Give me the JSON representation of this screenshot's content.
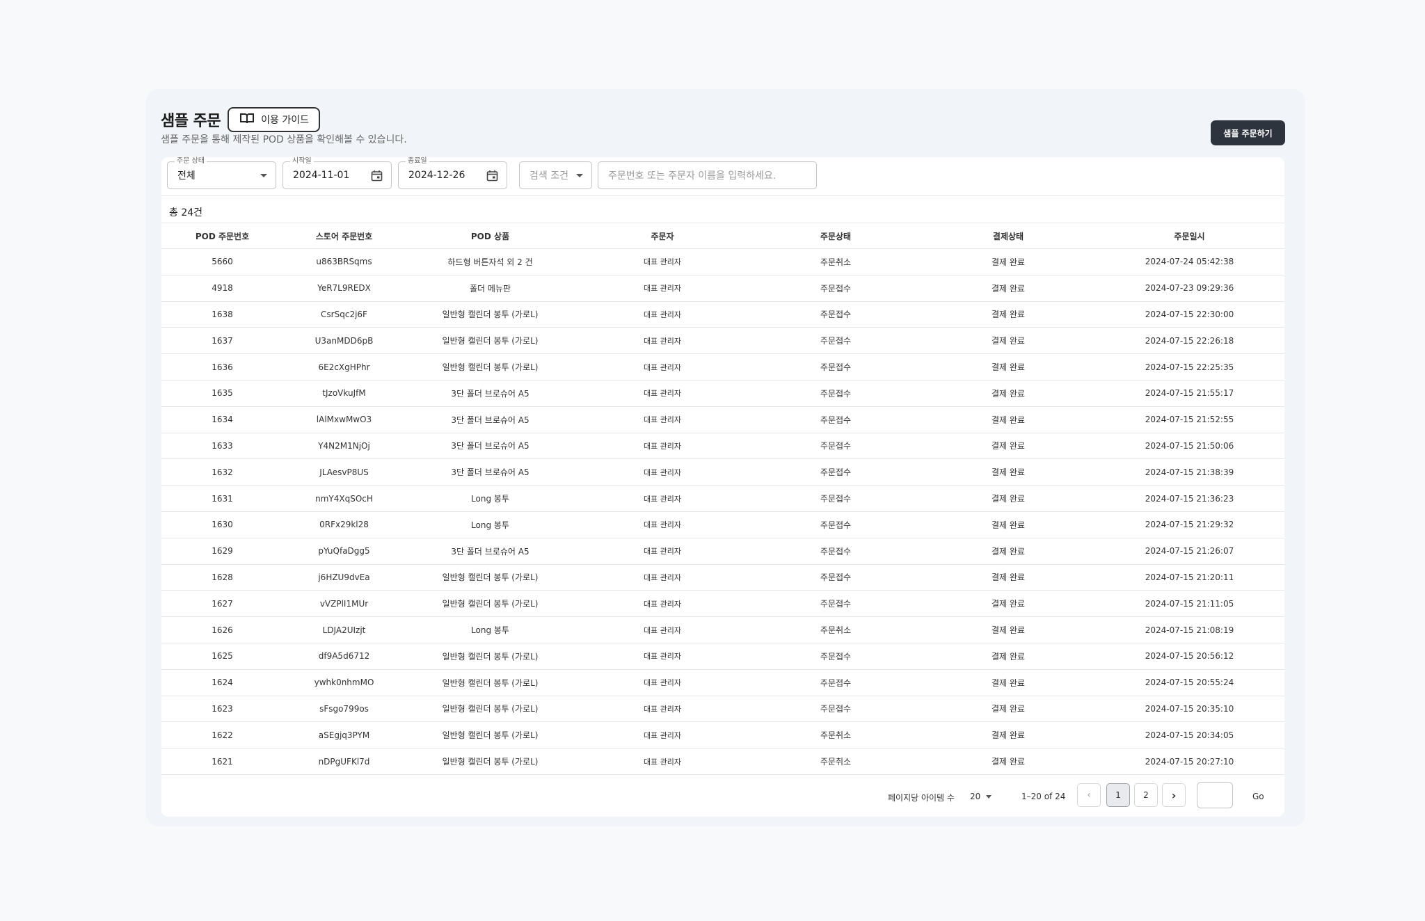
{
  "header": {
    "title": "샘플 주문",
    "guide_label": "이용 가이드",
    "subtitle": "샘플 주문을 통해 제작된 POD 상품을 확인해볼 수 있습니다.",
    "order_button": "샘플 주문하기"
  },
  "filters": {
    "status": {
      "label": "주문 상태",
      "value": "전체"
    },
    "start_date": {
      "label": "시작일",
      "value": "2024-11-01"
    },
    "end_date": {
      "label": "종료일",
      "value": "2024-12-26"
    },
    "search_condition": {
      "value": "검색 조건"
    },
    "search": {
      "placeholder": "주문번호 또는 주문자 이름을 입력하세요."
    }
  },
  "total": "총 24건",
  "table": {
    "headers": [
      "POD 주문번호",
      "스토어 주문번호",
      "POD 상품",
      "주문자",
      "주문상태",
      "결제상태",
      "주문일시"
    ],
    "rows": [
      [
        "5660",
        "u863BRSqms",
        "하드형 버튼자석 외 2 건",
        "대표 관리자",
        "주문취소",
        "결제 완료",
        "2024-07-24 05:42:38"
      ],
      [
        "4918",
        "YeR7L9REDX",
        "폴더 메뉴판",
        "대표 관리자",
        "주문접수",
        "결제 완료",
        "2024-07-23 09:29:36"
      ],
      [
        "1638",
        "CsrSqc2j6F",
        "일반형 캘린더 봉투 (가로L)",
        "대표 관리자",
        "주문접수",
        "결제 완료",
        "2024-07-15 22:30:00"
      ],
      [
        "1637",
        "U3anMDD6pB",
        "일반형 캘린더 봉투 (가로L)",
        "대표 관리자",
        "주문접수",
        "결제 완료",
        "2024-07-15 22:26:18"
      ],
      [
        "1636",
        "6E2cXgHPhr",
        "일반형 캘린더 봉투 (가로L)",
        "대표 관리자",
        "주문접수",
        "결제 완료",
        "2024-07-15 22:25:35"
      ],
      [
        "1635",
        "tJzoVkuJfM",
        "3단 폴더 브로슈어 A5",
        "대표 관리자",
        "주문접수",
        "결제 완료",
        "2024-07-15 21:55:17"
      ],
      [
        "1634",
        "lAlMxwMwO3",
        "3단 폴더 브로슈어 A5",
        "대표 관리자",
        "주문접수",
        "결제 완료",
        "2024-07-15 21:52:55"
      ],
      [
        "1633",
        "Y4N2M1NjOj",
        "3단 폴더 브로슈어 A5",
        "대표 관리자",
        "주문접수",
        "결제 완료",
        "2024-07-15 21:50:06"
      ],
      [
        "1632",
        "JLAesvP8US",
        "3단 폴더 브로슈어 A5",
        "대표 관리자",
        "주문접수",
        "결제 완료",
        "2024-07-15 21:38:39"
      ],
      [
        "1631",
        "nmY4XqSOcH",
        "Long 봉투",
        "대표 관리자",
        "주문접수",
        "결제 완료",
        "2024-07-15 21:36:23"
      ],
      [
        "1630",
        "0RFx29kl28",
        "Long 봉투",
        "대표 관리자",
        "주문접수",
        "결제 완료",
        "2024-07-15 21:29:32"
      ],
      [
        "1629",
        "pYuQfaDgg5",
        "3단 폴더 브로슈어 A5",
        "대표 관리자",
        "주문접수",
        "결제 완료",
        "2024-07-15 21:26:07"
      ],
      [
        "1628",
        "j6HZU9dvEa",
        "일반형 캘린더 봉투 (가로L)",
        "대표 관리자",
        "주문접수",
        "결제 완료",
        "2024-07-15 21:20:11"
      ],
      [
        "1627",
        "vVZPlI1MUr",
        "일반형 캘린더 봉투 (가로L)",
        "대표 관리자",
        "주문접수",
        "결제 완료",
        "2024-07-15 21:11:05"
      ],
      [
        "1626",
        "LDJA2UIzjt",
        "Long 봉투",
        "대표 관리자",
        "주문취소",
        "결제 완료",
        "2024-07-15 21:08:19"
      ],
      [
        "1625",
        "df9A5d6712",
        "일반형 캘린더 봉투 (가로L)",
        "대표 관리자",
        "주문접수",
        "결제 완료",
        "2024-07-15 20:56:12"
      ],
      [
        "1624",
        "ywhk0nhmMO",
        "일반형 캘린더 봉투 (가로L)",
        "대표 관리자",
        "주문접수",
        "결제 완료",
        "2024-07-15 20:55:24"
      ],
      [
        "1623",
        "sFsgo799os",
        "일반형 캘린더 봉투 (가로L)",
        "대표 관리자",
        "주문접수",
        "결제 완료",
        "2024-07-15 20:35:10"
      ],
      [
        "1622",
        "aSEgjq3PYM",
        "일반형 캘린더 봉투 (가로L)",
        "대표 관리자",
        "주문취소",
        "결제 완료",
        "2024-07-15 20:34:05"
      ],
      [
        "1621",
        "nDPgUFKl7d",
        "일반형 캘린더 봉투 (가로L)",
        "대표 관리자",
        "주문취소",
        "결제 완료",
        "2024-07-15 20:27:10"
      ]
    ]
  },
  "pagination": {
    "per_page_label": "페이지당 아이템 수",
    "per_page_value": "20",
    "range": "1–20 of 24",
    "pages": [
      "1",
      "2"
    ],
    "current_page": "1",
    "go_label": "Go"
  },
  "icons": {
    "guide": "book-icon",
    "calendar": "calendar-icon",
    "dropdown": "caret-down-icon",
    "prev": "chevron-left-icon",
    "next": "chevron-right-icon"
  },
  "colors": {
    "primary_button": "#2d343e",
    "background": "#f8f9fb",
    "panel": "#f1f4f9"
  }
}
